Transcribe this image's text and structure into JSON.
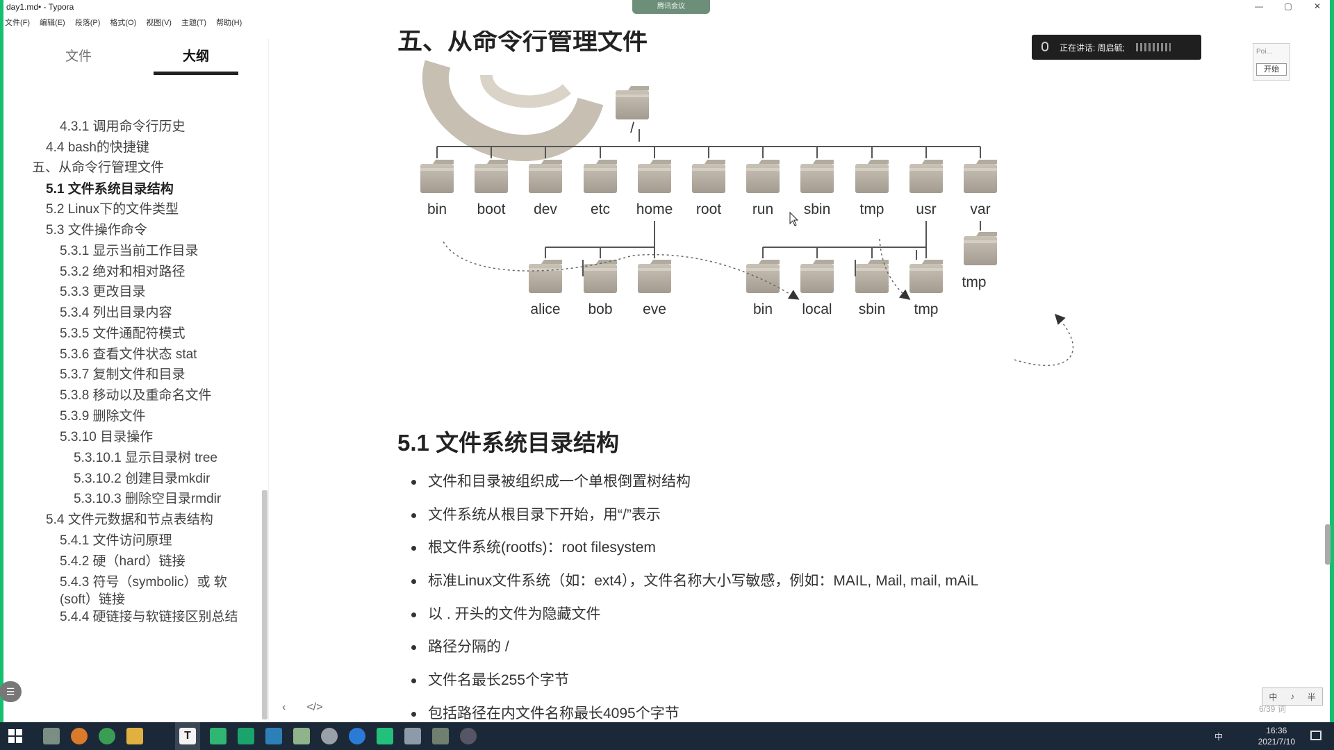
{
  "window": {
    "title": "day1.md• - Typora",
    "meeting_pill": "腾讯会议",
    "minimize": "—",
    "maximize": "▢",
    "close": "✕"
  },
  "menubar": [
    "文件(F)",
    "编辑(E)",
    "段落(P)",
    "格式(O)",
    "视图(V)",
    "主题(T)",
    "帮助(H)"
  ],
  "sidebar": {
    "tab_files": "文件",
    "tab_outline": "大纲",
    "items": [
      "4.3.1 调用命令行历史",
      "4.4 bash的快捷键",
      "五、从命令行管理文件",
      "5.1 文件系统目录结构",
      "5.2 Linux下的文件类型",
      "5.3 文件操作命令",
      "5.3.1 显示当前工作目录",
      "5.3.2 绝对和相对路径",
      "5.3.3 更改目录",
      "5.3.4 列出目录内容",
      "5.3.5 文件通配符模式",
      "5.3.6 查看文件状态 stat",
      "5.3.7 复制文件和目录",
      "5.3.8 移动以及重命名文件",
      "5.3.9 删除文件",
      "5.3.10 目录操作",
      "5.3.10.1 显示目录树 tree",
      "5.3.10.2 创建目录mkdir",
      "5.3.10.3 删除空目录rmdir",
      "5.4 文件元数据和节点表结构",
      "5.4.1 文件访问原理",
      "5.4.2 硬（hard）链接",
      "5.4.3 符号（symbolic）或 软(soft）链接",
      "5.4.4 硬链接与软链接区别总结"
    ],
    "toggle_icon": "☰"
  },
  "content": {
    "heading_cut": "五、从命令行管理文件",
    "diagram": {
      "root": "/",
      "top_dirs": [
        "bin",
        "boot",
        "dev",
        "etc",
        "home",
        "root",
        "run",
        "sbin",
        "tmp",
        "usr",
        "var"
      ],
      "home_dirs": [
        "alice",
        "bob",
        "eve"
      ],
      "usr_dirs": [
        "bin",
        "local",
        "sbin",
        "tmp"
      ],
      "var_dirs": [
        "tmp"
      ]
    },
    "heading": "5.1 文件系统目录结构",
    "bullets": [
      "文件和目录被组织成一个单根倒置树结构",
      "文件系统从根目录下开始，用“/”表示",
      "根文件系统(rootfs)：root filesystem",
      "标准Linux文件系统（如：ext4），文件名称大小写敏感，例如：MAIL, Mail, mail, mAiL",
      "以 . 开头的文件为隐藏文件",
      "路径分隔的 /",
      "文件名最长255个字节",
      "包括路径在内文件名称最长4095个字节"
    ],
    "nav_prev": "‹",
    "nav_source": "</>"
  },
  "overlay": {
    "speaking_text": "正在讲话: 周启毓;",
    "widget_label": "Poi...",
    "widget_button": "开始",
    "ime_bar": [
      "中",
      "♪",
      "半"
    ],
    "word_count": "6/39 词"
  },
  "taskbar": {
    "ime": "中",
    "time": "16:36",
    "date": "2021/7/10"
  }
}
